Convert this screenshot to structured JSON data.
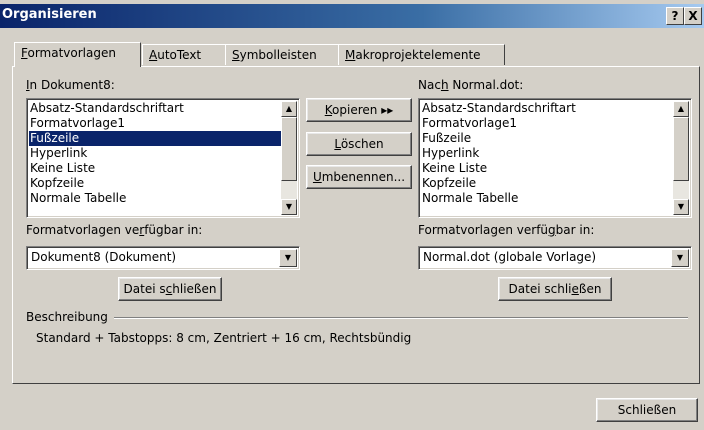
{
  "window": {
    "title": "Organisieren",
    "help_glyph": "?",
    "close_glyph": "X"
  },
  "tabs": [
    {
      "label": "Formatvorlagen",
      "accel": "F",
      "rest": "ormatvorlagen",
      "active": true
    },
    {
      "label": "AutoText",
      "accel": "A",
      "rest": "utoText",
      "active": false
    },
    {
      "label": "Symbolleisten",
      "accel": "S",
      "rest": "ymbolleisten",
      "active": false
    },
    {
      "label": "Makroprojektelemente",
      "accel": "M",
      "rest": "akroprojektelemente",
      "active": false
    }
  ],
  "left": {
    "label_accel": "I",
    "label_rest": "n Dokument8:",
    "items": [
      "Absatz-Standardschriftart",
      "Formatvorlage1",
      "Fußzeile",
      "Hyperlink",
      "Keine Liste",
      "Kopfzeile",
      "Normale Tabelle"
    ],
    "selected_index": 2,
    "avail_label_pre": "Formatvorlagen ve",
    "avail_label_accel": "r",
    "avail_label_post": "fügbar in:",
    "combo_value": "Dokument8 (Dokument)",
    "close_pre": "Datei s",
    "close_accel": "c",
    "close_post": "hließen"
  },
  "right": {
    "label_pre": "Nac",
    "label_accel": "h",
    "label_post": " Normal.dot:",
    "items": [
      "Absatz-Standardschriftart",
      "Formatvorlage1",
      "Fußzeile",
      "Hyperlink",
      "Keine Liste",
      "Kopfzeile",
      "Normale Tabelle"
    ],
    "avail_label_pre": "Formatvorlagen verfü",
    "avail_label_accel": "g",
    "avail_label_post": "bar in:",
    "combo_value": "Normal.dot (globale Vorlage)",
    "close_pre": "Datei schli",
    "close_accel": "e",
    "close_post": "ßen"
  },
  "middle": {
    "copy_accel": "K",
    "copy_rest": "opieren",
    "copy_arrows": "▸▸",
    "delete_accel": "L",
    "delete_rest": "öschen",
    "rename_accel": "U",
    "rename_rest": "mbenennen..."
  },
  "description": {
    "heading": "Beschreibung",
    "text": "Standard + Tabstopps:  8 cm, Zentriert +  16 cm, Rechtsbündig"
  },
  "footer": {
    "close_label": "Schließen"
  },
  "icons": {
    "scroll_up": "▲",
    "scroll_down": "▼",
    "dropdown": "▼"
  }
}
